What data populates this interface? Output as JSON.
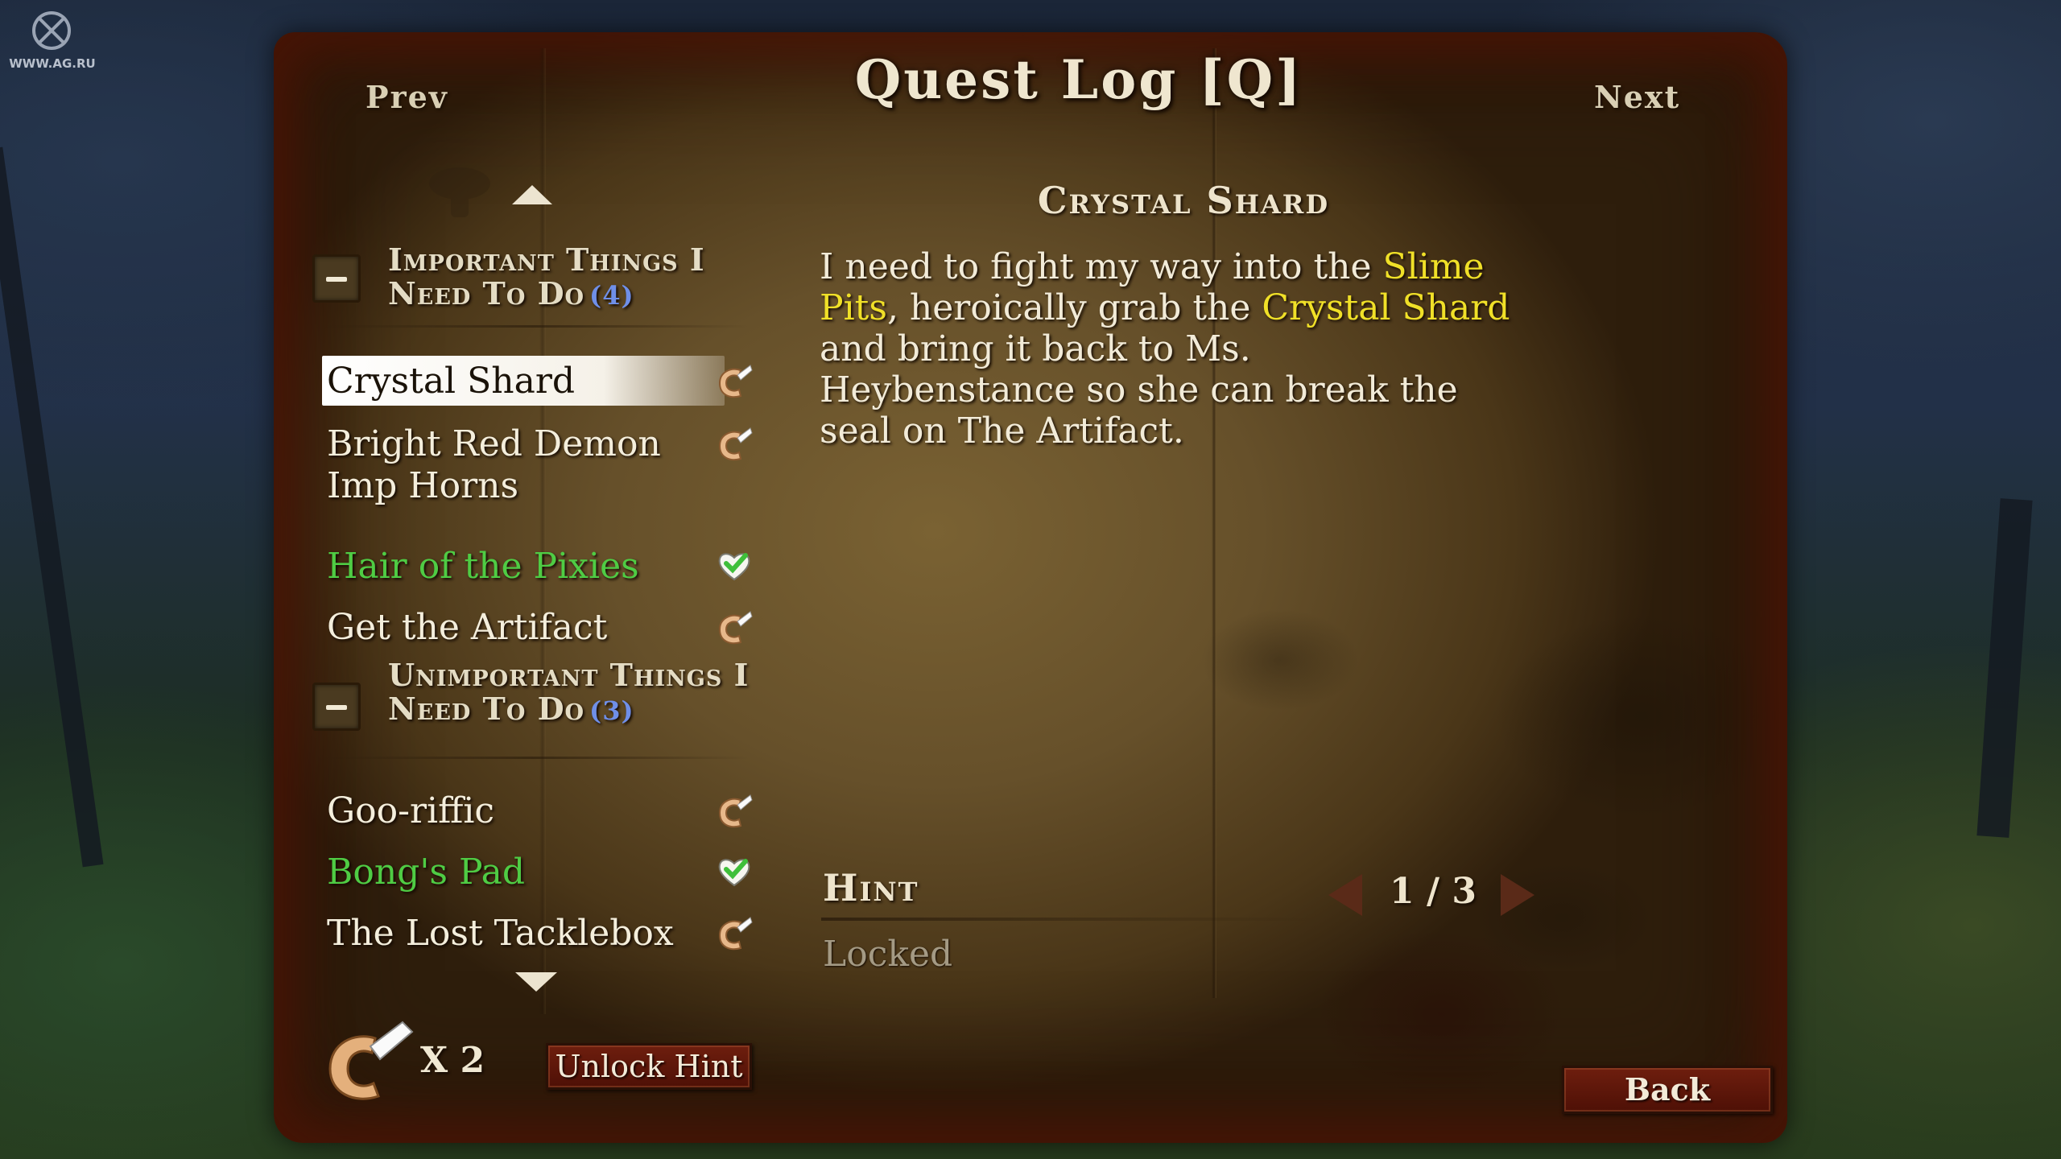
{
  "watermark": {
    "text": "WWW.AG.RU",
    "icon": "ag-logo-icon"
  },
  "header": {
    "prev_label": "Prev",
    "title": "Quest Log [Q]",
    "next_label": "Next"
  },
  "quest_list": {
    "categories": [
      {
        "title": "Important Things I Need To Do",
        "count": "(4)"
      },
      {
        "title": "Unimportant Things I Need To Do",
        "count": "(3)"
      }
    ],
    "quests": [
      {
        "label": "Crystal Shard",
        "status": "active",
        "icon": "fortune-cookie-icon"
      },
      {
        "label": "Bright Red Demon Imp Horns",
        "status": "active",
        "icon": "fortune-cookie-icon"
      },
      {
        "label": "Hair of the Pixies",
        "status": "complete",
        "icon": "heart-check-icon"
      },
      {
        "label": "Get the Artifact",
        "status": "active",
        "icon": "fortune-cookie-icon"
      },
      {
        "label": "Goo-riffic",
        "status": "active",
        "icon": "fortune-cookie-icon"
      },
      {
        "label": "Bong's Pad",
        "status": "complete",
        "icon": "heart-check-icon"
      },
      {
        "label": "The Lost Tacklebox",
        "status": "active",
        "icon": "fortune-cookie-icon"
      }
    ]
  },
  "hint_tokens": {
    "count_label": "X 2",
    "icon": "fortune-cookie-icon"
  },
  "buttons": {
    "unlock_hint": "Unlock Hint",
    "back": "Back"
  },
  "detail": {
    "title": "Crystal Shard",
    "body": {
      "p1": "I need to fight my way into the ",
      "h1": "Slime Pits",
      "p2": ", heroically grab the ",
      "h2": "Crystal Shard",
      "p3": " and bring it back to Ms. Heybenstance so she can break the seal on The Artifact."
    },
    "hint_label": "Hint",
    "hint_page": "1 / 3",
    "hint_text": "Locked"
  },
  "colors": {
    "highlight": "#f0e028",
    "complete": "#4fcc44",
    "count": "#6f8fe8",
    "button": "#5e160a"
  }
}
